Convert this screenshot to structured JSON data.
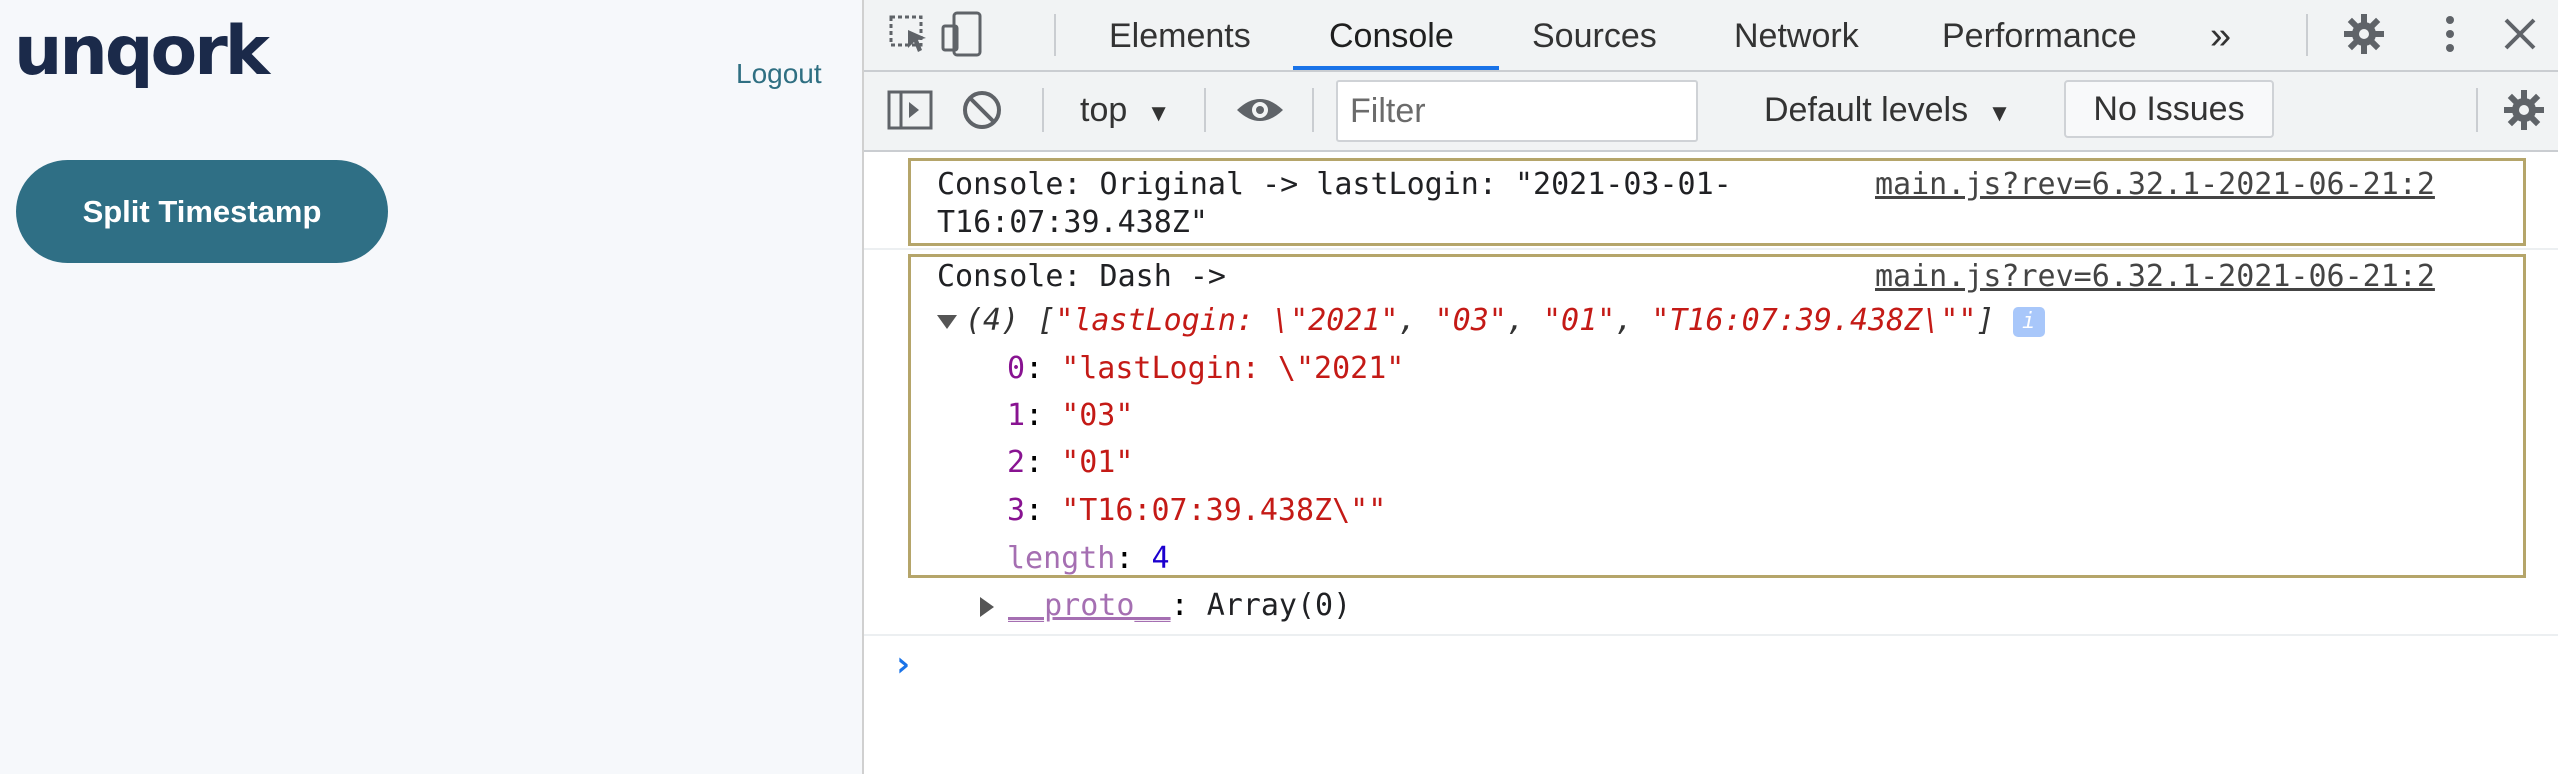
{
  "app": {
    "logo_text": "unqork",
    "logout_label": "Logout",
    "button_label": "Split Timestamp"
  },
  "devtools": {
    "tabs": [
      "Elements",
      "Console",
      "Sources",
      "Network",
      "Performance"
    ],
    "active_tab": "Console",
    "more_tabs": "»",
    "toolbar": {
      "context": "top",
      "filter_placeholder": "Filter",
      "levels": "Default levels",
      "issues": "No Issues"
    },
    "icons": {
      "inspect": "inspect-icon",
      "device": "device-toolbar-icon",
      "settings": "gear-icon",
      "menu": "kebab-menu-icon",
      "close": "close-icon",
      "sidebar": "sidebar-toggle-icon",
      "clear": "clear-console-icon",
      "eye": "live-expression-icon"
    }
  },
  "console": {
    "msg1": {
      "text_line1": "Console: Original -> lastLogin: \"2021-03-01-",
      "text_line2": "T16:07:39.438Z\"",
      "source": "main.js?rev=6.32.1-2021-06-21:2"
    },
    "msg2": {
      "text": "Console: Dash ->",
      "source": "main.js?rev=6.32.1-2021-06-21:2",
      "array_count": "(4)",
      "array_preview": [
        "\"lastLogin: \\\"2021\"",
        "\"03\"",
        "\"01\"",
        "\"T16:07:39.438Z\\\"\""
      ],
      "items": [
        {
          "index": "0",
          "value": "\"lastLogin: \\\"2021\""
        },
        {
          "index": "1",
          "value": "\"03\""
        },
        {
          "index": "2",
          "value": "\"01\""
        },
        {
          "index": "3",
          "value": "\"T16:07:39.438Z\\\"\""
        }
      ],
      "length_key": "length",
      "length_value": "4",
      "proto_key": "__proto__",
      "proto_value": "Array(0)"
    },
    "prompt": "›"
  }
}
